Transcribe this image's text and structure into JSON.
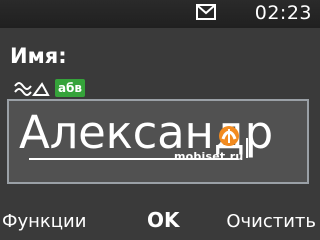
{
  "status_bar": {
    "time": "02:23",
    "message_icon": "envelope-icon"
  },
  "field": {
    "label": "Имя:",
    "value": "Александр"
  },
  "input_mode": {
    "predictive_icon": "predictive-text-icon",
    "mode_badge": "абв",
    "badge_color": "#35a33a"
  },
  "watermark": {
    "text": "mobiset.ru",
    "logo_color": "#f28b20"
  },
  "softkeys": {
    "left": "Функции",
    "center": "OK",
    "right": "Очистить"
  }
}
